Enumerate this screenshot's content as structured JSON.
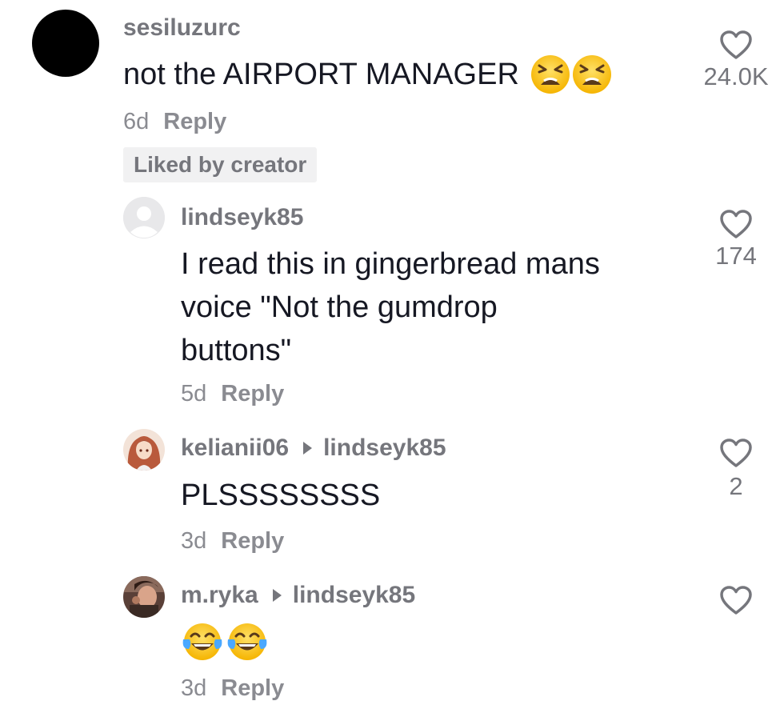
{
  "comments": [
    {
      "username": "sesiluzurc",
      "text": "not the AIRPORT MANAGER",
      "emojis": [
        "tired-face-emoji",
        "tired-face-emoji"
      ],
      "age": "6d",
      "reply_label": "Reply",
      "badge": "Liked by creator",
      "likes": "24.0K",
      "avatar": "black-circle"
    },
    {
      "username": "lindseyk85",
      "text_lines": [
        "I read this in gingerbread mans",
        "voice \"Not the gumdrop",
        "buttons\""
      ],
      "age": "5d",
      "reply_label": "Reply",
      "likes": "174",
      "avatar": "default-user-icon"
    },
    {
      "username": "kelianii06",
      "reply_to": "lindseyk85",
      "text": "PLSSSSSSSS",
      "age": "3d",
      "reply_label": "Reply",
      "likes": "2",
      "avatar": "anime-character-photo"
    },
    {
      "username": "m.ryka",
      "reply_to": "lindseyk85",
      "emojis": [
        "face-with-tears-of-joy-emoji",
        "face-with-tears-of-joy-emoji"
      ],
      "age": "3d",
      "reply_label": "Reply",
      "avatar": "person-photo"
    }
  ],
  "colors": {
    "primary_text": "#161823",
    "secondary_text": "#75767c",
    "badge_bg": "#f1f1f2",
    "heart_stroke": "#75767c",
    "emoji_yellow": "#ffcc33"
  }
}
